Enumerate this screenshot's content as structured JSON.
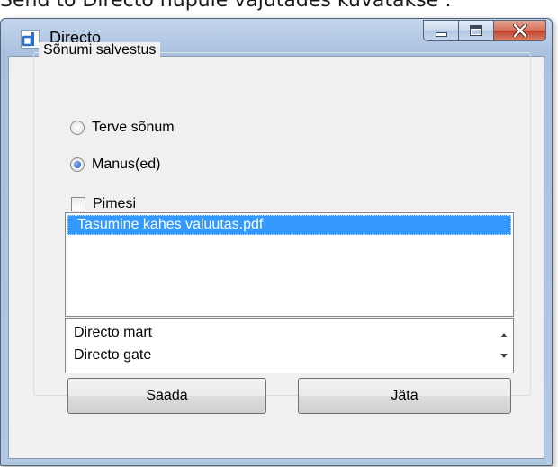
{
  "caption": "Send to Directo nupule vajutades kuvatakse :",
  "window": {
    "title": "Directo",
    "icon": "directo-logo-icon",
    "controls": [
      "minimize-icon",
      "maximize-icon",
      "close-icon"
    ]
  },
  "group": {
    "title": "Sõnumi salvestus",
    "options": [
      {
        "label": "Terve sõnum",
        "checked": false
      },
      {
        "label": "Manus(ed)",
        "checked": true
      }
    ],
    "checkbox": {
      "label": "Pimesi",
      "checked": false
    }
  },
  "attachments": {
    "items": [
      "Tasumine kahes valuutas.pdf"
    ],
    "selected": "Tasumine kahes valuutas.pdf"
  },
  "destinations": {
    "items": [
      "Directo mart",
      "Directo gate"
    ]
  },
  "buttons": {
    "send": "Saada",
    "cancel": "Jäta"
  },
  "colors": {
    "selection": "#3399ff",
    "title_bar": "#b3c8e3",
    "close_button": "#c2412a",
    "logo": "#2a6fd6"
  }
}
